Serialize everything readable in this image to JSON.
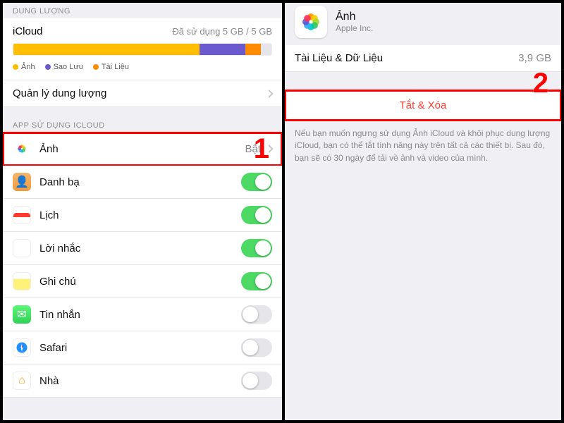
{
  "left": {
    "section_storage": "DUNG LƯỢNG",
    "icloud_label": "iCloud",
    "usage_text": "Đã sử dụng 5 GB / 5 GB",
    "segments": [
      {
        "color": "#ffbf00",
        "pct": 72,
        "name": "Ảnh"
      },
      {
        "color": "#6a5acd",
        "pct": 18,
        "name": "Sao Lưu"
      },
      {
        "color": "#ff8c00",
        "pct": 6,
        "name": "Tài Liệu"
      }
    ],
    "manage_label": "Quản lý dung lượng",
    "section_apps": "APP SỬ DỤNG ICLOUD",
    "apps": [
      {
        "name": "Ảnh",
        "icon": "photos",
        "control": "disclosure",
        "detail": "Bật",
        "highlight": true
      },
      {
        "name": "Danh bạ",
        "icon": "contacts",
        "control": "toggle",
        "on": true
      },
      {
        "name": "Lịch",
        "icon": "calendar",
        "control": "toggle",
        "on": true
      },
      {
        "name": "Lời nhắc",
        "icon": "reminders",
        "control": "toggle",
        "on": true
      },
      {
        "name": "Ghi chú",
        "icon": "notes",
        "control": "toggle",
        "on": true
      },
      {
        "name": "Tin nhắn",
        "icon": "messages",
        "control": "toggle",
        "on": false
      },
      {
        "name": "Safari",
        "icon": "safari",
        "control": "toggle",
        "on": false
      },
      {
        "name": "Nhà",
        "icon": "home",
        "control": "toggle",
        "on": false
      }
    ],
    "callout": "1"
  },
  "right": {
    "app_name": "Ảnh",
    "vendor": "Apple Inc.",
    "data_row_label": "Tài Liệu & Dữ Liệu",
    "data_row_value": "3,9 GB",
    "action_label": "Tắt & Xóa",
    "footnote": "Nếu bạn muốn ngưng sử dụng Ảnh iCloud và khôi phục dung lượng iCloud, bạn có thể tắt tính năng này trên tất cả các thiết bị. Sau đó, bạn sẽ có 30 ngày để tải về ảnh và video của mình.",
    "callout": "2"
  },
  "colors": {
    "petals": [
      "#ff9500",
      "#ffcc00",
      "#a2d729",
      "#34c759",
      "#00c7be",
      "#30b0ff",
      "#5856d6",
      "#ff2d55"
    ]
  }
}
